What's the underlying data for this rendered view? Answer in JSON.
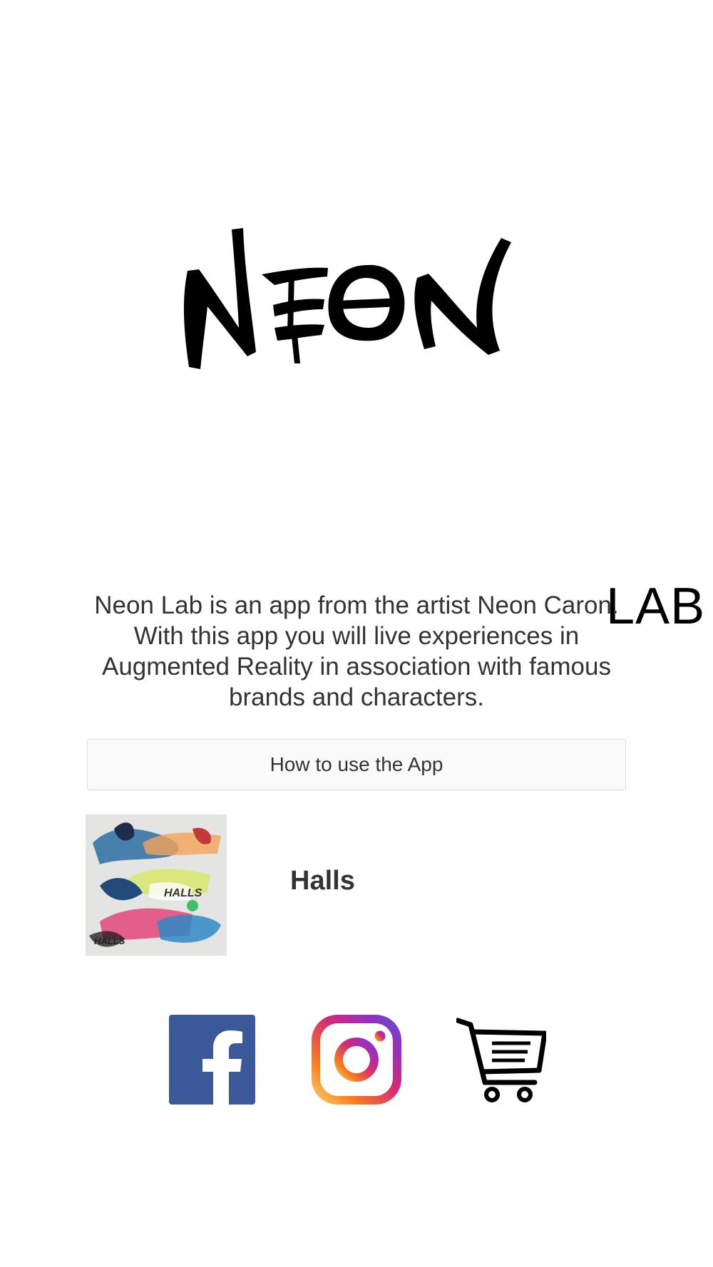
{
  "logo": {
    "main_text": "NEON",
    "sub_text": "LAB"
  },
  "description": "Neon Lab is an app from the artist Neon Caron. With this app you will live experiences in Augmented Reality in association with famous brands and characters.",
  "how_to_button": {
    "label": "How to use the App"
  },
  "items": [
    {
      "title": "Halls",
      "thumbnail_text": "HALLS"
    }
  ],
  "social": {
    "facebook": {
      "icon": "facebook-icon",
      "color": "#3b5998"
    },
    "instagram": {
      "icon": "instagram-icon",
      "colors": [
        "#feda75",
        "#fa7e1e",
        "#d62976",
        "#962fbf",
        "#4f5bd5"
      ]
    },
    "shop": {
      "icon": "shopping-cart-icon",
      "color": "#000000"
    }
  }
}
